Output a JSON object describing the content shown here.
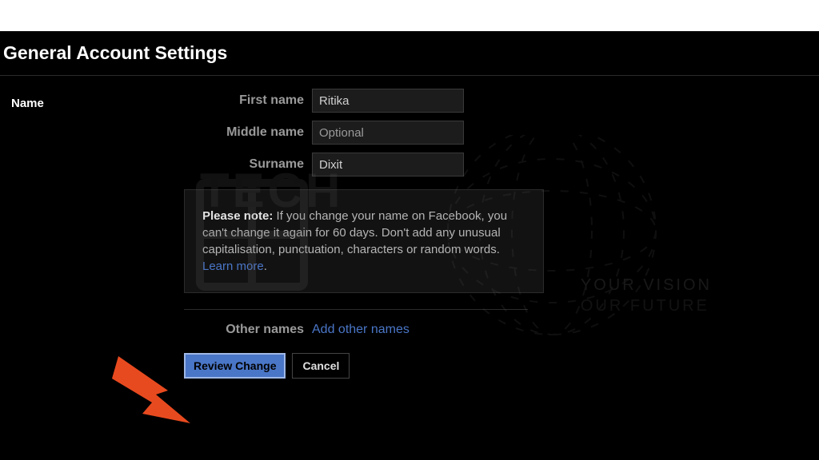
{
  "page_title": "General Account Settings",
  "section_name": "Name",
  "fields": {
    "first_name": {
      "label": "First name",
      "value": "Ritika"
    },
    "middle_name": {
      "label": "Middle name",
      "value": "",
      "placeholder": "Optional"
    },
    "surname": {
      "label": "Surname",
      "value": "Dixit"
    }
  },
  "note": {
    "heading": "Please note:",
    "body": "If you change your name on Facebook, you can't change it again for 60 days. Don't add any unusual capitalisation, punctuation, characters or random words.",
    "learn_more": "Learn more",
    "period": "."
  },
  "other_names": {
    "label": "Other names",
    "link": "Add other names"
  },
  "buttons": {
    "review": "Review Change",
    "cancel": "Cancel"
  },
  "watermark": {
    "line1": "YOUR VISION",
    "line2": "OUR FUTURE"
  },
  "colors": {
    "link": "#4a76c7",
    "bg": "#000000",
    "accent_arrow": "#e84a1f"
  }
}
